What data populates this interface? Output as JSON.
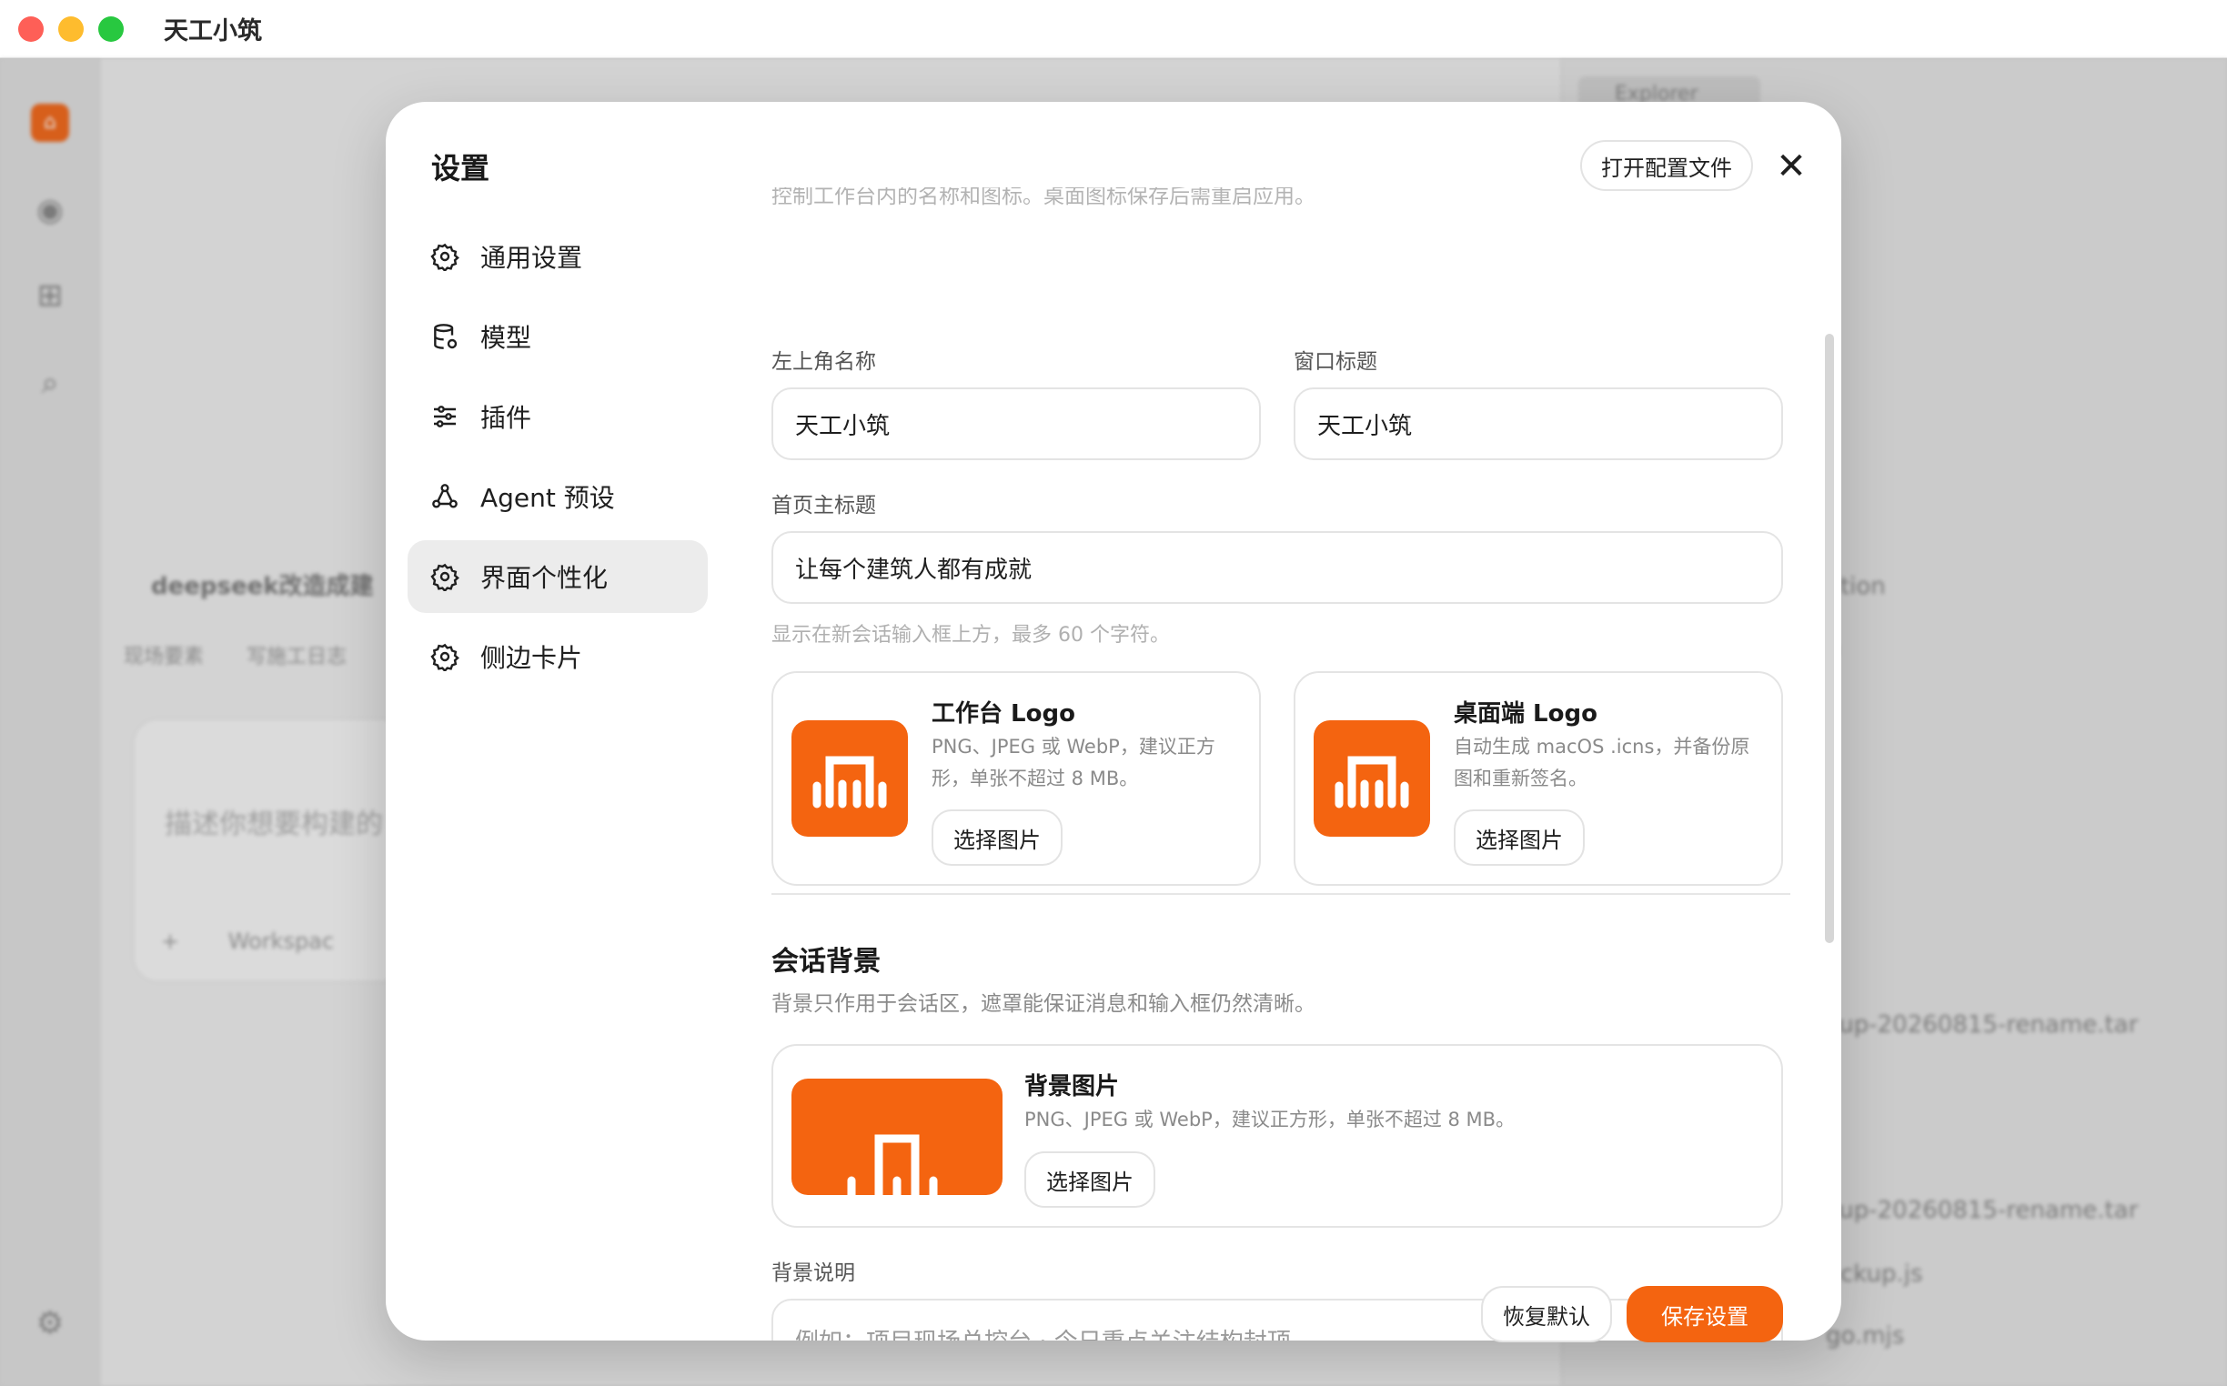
{
  "window": {
    "title": "天工小筑"
  },
  "background": {
    "explorer_tab": "Explorer",
    "folder": "deepseek改造成建",
    "chips": [
      "现场要素",
      "写施工日志"
    ],
    "input_placeholder": "描述你想要构建的",
    "input_tools": "Workspac",
    "files": [
      "ation",
      "n",
      "kup-20260815-rename.tar",
      "kup-20260815-rename.tar",
      "ackup.js",
      "go.mjs"
    ]
  },
  "settings": {
    "title": "设置",
    "open_config_label": "打开配置文件",
    "close_icon": "close-icon",
    "nav": [
      {
        "label": "通用设置",
        "icon": "gear-icon"
      },
      {
        "label": "模型",
        "icon": "database-icon"
      },
      {
        "label": "插件",
        "icon": "sliders-icon"
      },
      {
        "label": "Agent 预设",
        "icon": "share-icon"
      },
      {
        "label": "界面个性化",
        "icon": "gear-icon",
        "active": true
      },
      {
        "label": "侧边卡片",
        "icon": "gear-icon"
      }
    ],
    "cut_text": "控制工作台内的名称和图标。桌面图标保存后需重启应用。",
    "top_left_name": {
      "label": "左上角名称",
      "value": "天工小筑"
    },
    "window_title": {
      "label": "窗口标题",
      "value": "天工小筑"
    },
    "home_title": {
      "label": "首页主标题",
      "value": "让每个建筑人都有成就",
      "hint": "显示在新会话输入框上方，最多 60 个字符。"
    },
    "workbench_logo": {
      "title": "工作台 Logo",
      "desc": "PNG、JPEG 或 WebP，建议正方形，单张不超过 8 MB。",
      "button": "选择图片"
    },
    "desktop_logo": {
      "title": "桌面端 Logo",
      "desc": "自动生成 macOS .icns，并备份原图和重新签名。",
      "button": "选择图片"
    },
    "chat_bg": {
      "title": "会话背景",
      "desc": "背景只作用于会话区，遮罩能保证消息和输入框仍然清晰。",
      "image_title": "背景图片",
      "image_desc": "PNG、JPEG 或 WebP，建议正方形，单张不超过 8 MB。",
      "button": "选择图片"
    },
    "bg_note": {
      "label": "背景说明",
      "placeholder": "例如：项目现场总控台 · 今日重点关注结构封顶"
    },
    "reset_label": "恢复默认",
    "save_label": "保存设置",
    "accent": "#f46410"
  }
}
